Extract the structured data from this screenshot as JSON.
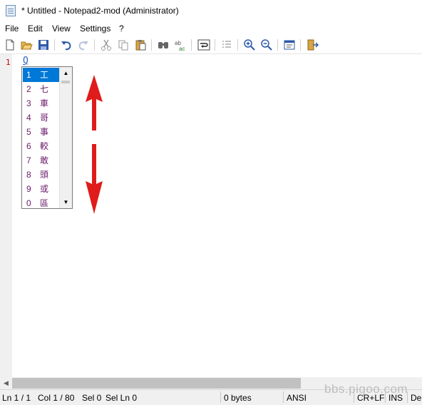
{
  "window": {
    "title": "* Untitled - Notepad2-mod (Administrator)",
    "icon": "notepad-icon"
  },
  "menu": [
    "File",
    "Edit",
    "View",
    "Settings",
    "?"
  ],
  "toolbar": [
    "new-file-icon",
    "open-file-icon",
    "save-icon",
    "undo-icon",
    "redo-icon",
    "cut-icon",
    "copy-icon",
    "paste-icon",
    "find-icon",
    "replace-icon",
    "word-wrap-icon",
    "bookmark-list-icon",
    "zoom-in-icon",
    "zoom-out-icon",
    "scheme-icon",
    "exit-icon"
  ],
  "editor": {
    "line_number": "1",
    "typed_text": "Q"
  },
  "candidates": [
    {
      "idx": "1",
      "char": "工"
    },
    {
      "idx": "2",
      "char": "七"
    },
    {
      "idx": "3",
      "char": "車"
    },
    {
      "idx": "4",
      "char": "哥"
    },
    {
      "idx": "5",
      "char": "事"
    },
    {
      "idx": "6",
      "char": "較"
    },
    {
      "idx": "7",
      "char": "敢"
    },
    {
      "idx": "8",
      "char": "頭"
    },
    {
      "idx": "9",
      "char": "或"
    },
    {
      "idx": "0",
      "char": "區"
    }
  ],
  "annotation_color": "#e01b1b",
  "status": {
    "ln": "Ln 1 / 1",
    "col": "Col 1 / 80",
    "sel": "Sel 0",
    "sel_ln": "Sel Ln 0",
    "size": "0 bytes",
    "encoding": "ANSI",
    "eol": "CR+LF",
    "ins": "INS",
    "scheme": "De"
  },
  "watermark": "bbs.pigoo.com"
}
